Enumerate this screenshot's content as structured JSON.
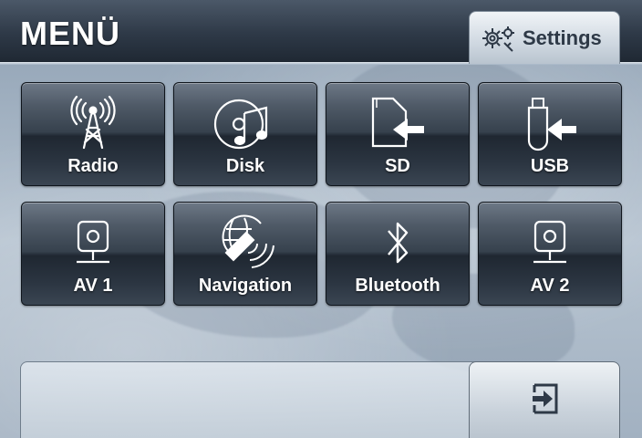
{
  "header": {
    "title": "MENÜ",
    "settings_label": "Settings",
    "settings_icon": "gears-icon"
  },
  "tiles": [
    {
      "label": "Radio",
      "icon": "radio-tower-icon"
    },
    {
      "label": "Disk",
      "icon": "disc-music-icon"
    },
    {
      "label": "SD",
      "icon": "sd-card-insert-icon"
    },
    {
      "label": "USB",
      "icon": "usb-stick-insert-icon"
    },
    {
      "label": "AV 1",
      "icon": "av-input-icon"
    },
    {
      "label": "Navigation",
      "icon": "globe-satellite-icon"
    },
    {
      "label": "Bluetooth",
      "icon": "bluetooth-icon"
    },
    {
      "label": "AV 2",
      "icon": "av-input-icon"
    }
  ],
  "footer": {
    "exit_icon": "exit-icon"
  }
}
